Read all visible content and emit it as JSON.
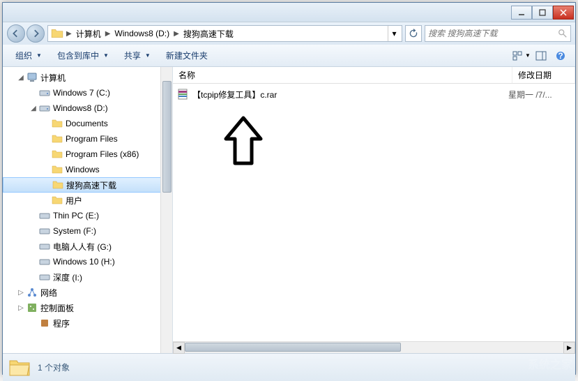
{
  "breadcrumb": {
    "items": [
      "计算机",
      "Windows8 (D:)",
      "搜狗高速下载"
    ]
  },
  "search": {
    "placeholder": "搜索 搜狗高速下载"
  },
  "toolbar": {
    "organize": "组织",
    "include": "包含到库中",
    "share": "共享",
    "new_folder": "新建文件夹"
  },
  "columns": {
    "name": "名称",
    "modified": "修改日期"
  },
  "tree": {
    "computer": "计算机",
    "drives": [
      {
        "label": "Windows 7  (C:)",
        "type": "drive"
      },
      {
        "label": "Windows8 (D:)",
        "type": "drive",
        "expanded": true,
        "children": [
          {
            "label": "Documents",
            "type": "folder"
          },
          {
            "label": "Program Files",
            "type": "folder"
          },
          {
            "label": "Program Files (x86)",
            "type": "folder"
          },
          {
            "label": "Windows",
            "type": "folder"
          },
          {
            "label": "搜狗高速下载",
            "type": "folder",
            "selected": true
          },
          {
            "label": "用户",
            "type": "folder"
          }
        ]
      },
      {
        "label": "Thin PC (E:)",
        "type": "drive"
      },
      {
        "label": "System (F:)",
        "type": "drive"
      },
      {
        "label": "电脑人人有 (G:)",
        "type": "drive"
      },
      {
        "label": "Windows 10 (H:)",
        "type": "drive"
      },
      {
        "label": "深度 (I:)",
        "type": "drive"
      }
    ],
    "network": "网络",
    "control_panel": "控制面板",
    "programs": "程序"
  },
  "files": [
    {
      "name": "【tcpip修复工具】c.rar",
      "date": "星期一 /7/...",
      "type": "rar"
    }
  ],
  "status": {
    "count_text": "1 个对象"
  },
  "watermark": "系统之家"
}
